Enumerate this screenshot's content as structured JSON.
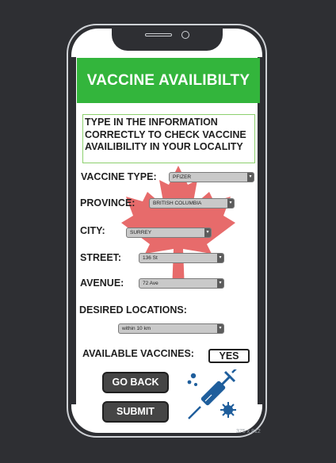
{
  "app": {
    "title": "VACCINE AVAILIBILTY",
    "instructions": "TYPE IN THE INFORMATION CORRECTLY TO CHECK VACCINE AVAILIBILITY IN YOUR LOCALITY"
  },
  "form": {
    "vaccine_type": {
      "label": "VACCINE TYPE:",
      "value": "PFIZER"
    },
    "province": {
      "label": "PROVINCE:",
      "value": "BRITISH COLUMBIA"
    },
    "city": {
      "label": "CITY:",
      "value": "SURREY"
    },
    "street": {
      "label": "STREET:",
      "value": "136 St"
    },
    "avenue": {
      "label": "AVENUE:",
      "value": "72 Ave"
    },
    "desired_locations": {
      "label": "DESIRED LOCATIONS:",
      "value": "within 10 km"
    }
  },
  "availability": {
    "label": "AVAILABLE VACCINES:",
    "value": "YES"
  },
  "buttons": {
    "go_back": "GO BACK",
    "submit": "SUBMIT"
  },
  "canvas_size_label": "375 x 812",
  "colors": {
    "header": "#33b53c",
    "leaf": "#e03a3a",
    "syringe": "#1f5e9c",
    "button": "#454545"
  },
  "icons": {
    "background": "maple-leaf-icon",
    "illustration": "vaccine-syringe-icon",
    "dropdown": "chevron-down-icon"
  }
}
